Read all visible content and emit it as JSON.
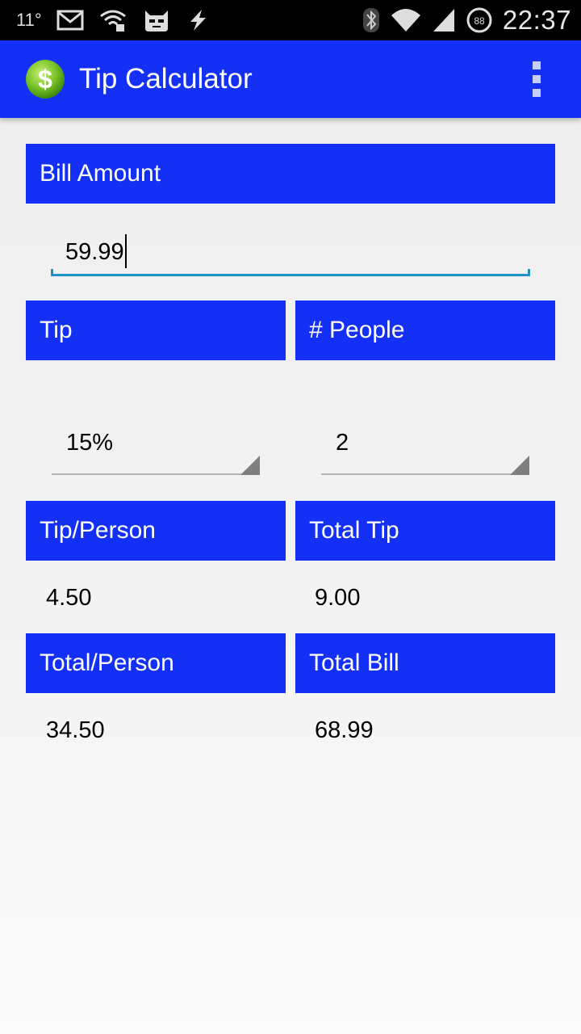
{
  "status_bar": {
    "temperature": "11°",
    "time": "22:37",
    "battery_level": "88",
    "icons": [
      "gmail-icon",
      "wifi-adb-icon",
      "cyanogen-mascot-icon",
      "lightning-icon",
      "bluetooth-icon",
      "wifi-icon",
      "signal-icon",
      "battery-icon"
    ]
  },
  "app_bar": {
    "title": "Tip Calculator",
    "app_icon": "dollar-coin-icon",
    "menu_icon": "overflow-menu-icon"
  },
  "bill": {
    "header": "Bill Amount",
    "value": "59.99"
  },
  "tip": {
    "header": "Tip",
    "selected": "15%"
  },
  "people": {
    "header": "# People",
    "selected": "2"
  },
  "results": {
    "tip_per_person": {
      "label": "Tip/Person",
      "value": "4.50"
    },
    "total_tip": {
      "label": "Total Tip",
      "value": "9.00"
    },
    "total_per_person": {
      "label": "Total/Person",
      "value": "34.50"
    },
    "total_bill": {
      "label": "Total Bill",
      "value": "68.99"
    }
  },
  "colors": {
    "accent": "#1530f5",
    "input_underline": "#1e90c8",
    "status_bar": "#000000"
  }
}
